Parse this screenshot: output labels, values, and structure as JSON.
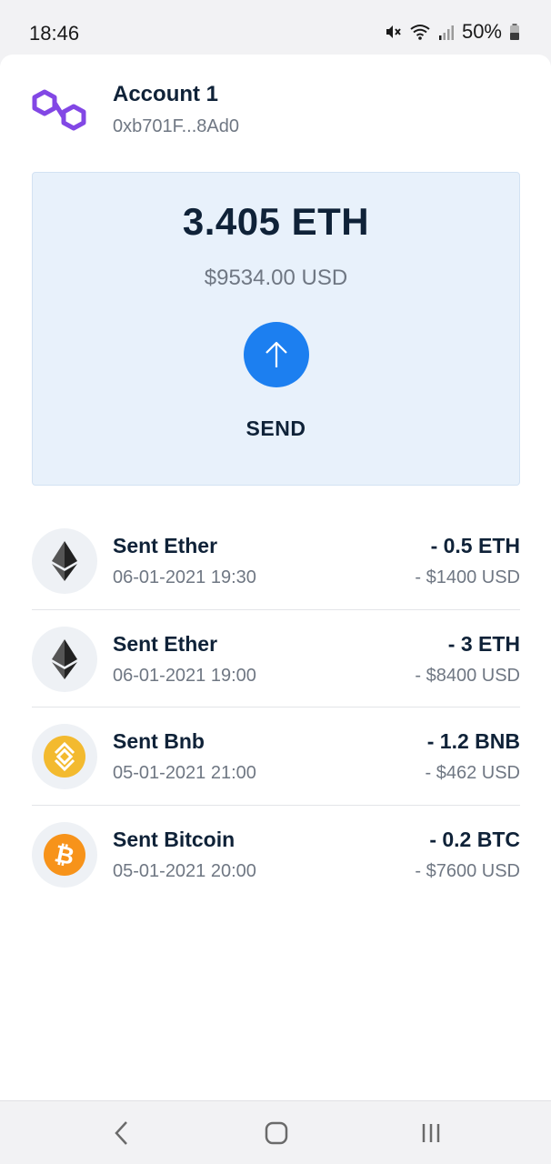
{
  "status_bar": {
    "time": "18:46",
    "battery": "50%",
    "icons": [
      "mute-icon",
      "wifi-icon",
      "signal-icon",
      "battery-icon"
    ]
  },
  "account": {
    "name": "Account 1",
    "address": "0xb701F...8Ad0",
    "logo_icon": "polygon-logo-icon"
  },
  "balance": {
    "amount": "3.405 ETH",
    "usd": "$9534.00 USD",
    "send_label": "SEND",
    "send_icon": "arrow-up-icon"
  },
  "transactions": [
    {
      "title": "Sent Ether",
      "date": "06-01-2021 19:30",
      "amount": "- 0.5 ETH",
      "usd": "- $1400 USD",
      "icon": "ethereum-icon"
    },
    {
      "title": "Sent Ether",
      "date": "06-01-2021 19:00",
      "amount": "- 3 ETH",
      "usd": "- $8400 USD",
      "icon": "ethereum-icon"
    },
    {
      "title": "Sent Bnb",
      "date": "05-01-2021 21:00",
      "amount": "- 1.2 BNB",
      "usd": "- $462 USD",
      "icon": "bnb-icon"
    },
    {
      "title": "Sent Bitcoin",
      "date": "05-01-2021 20:00",
      "amount": "- 0.2 BTC",
      "usd": "- $7600 USD",
      "icon": "bitcoin-icon"
    }
  ],
  "nav": {
    "items": [
      "back-icon",
      "home-icon",
      "recents-icon"
    ]
  },
  "colors": {
    "accent": "#1c7ff0",
    "panel": "#e8f1fb",
    "text_dark": "#0f2238",
    "text_muted": "#6f7783",
    "polygon": "#8247e5",
    "bnb": "#f3ba2f",
    "bitcoin": "#f7931a"
  }
}
